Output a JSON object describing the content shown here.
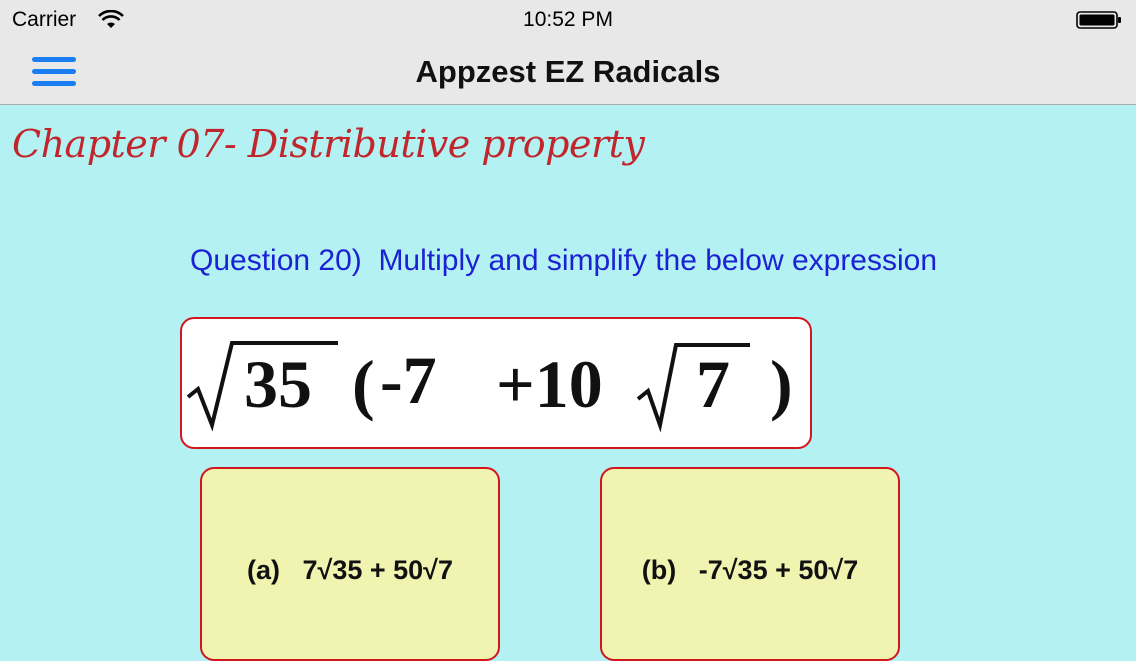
{
  "status_bar": {
    "carrier": "Carrier",
    "time": "10:52 PM"
  },
  "nav": {
    "title": "Appzest EZ Radicals",
    "menu_icon": "hamburger-menu-icon"
  },
  "chapter_title": "Chapter 07- Distributive property",
  "question": {
    "text": "Question 20)  Multiply and simplify the below expression"
  },
  "expression": {
    "radicand1": "35",
    "open": "(",
    "term1": "-7",
    "plus": "+10",
    "radicand2": "7",
    "close": ")"
  },
  "answers": [
    {
      "label": "(a)   7√35 + 50√7"
    },
    {
      "label": "(b)   -7√35 + 50√7"
    }
  ],
  "colors": {
    "background": "#b3f1f2",
    "chapter": "#c0262c",
    "question": "#1c22d4",
    "border": "#d2161d",
    "answer_bg": "#f1f4b0",
    "menu": "#1a7ef2"
  }
}
